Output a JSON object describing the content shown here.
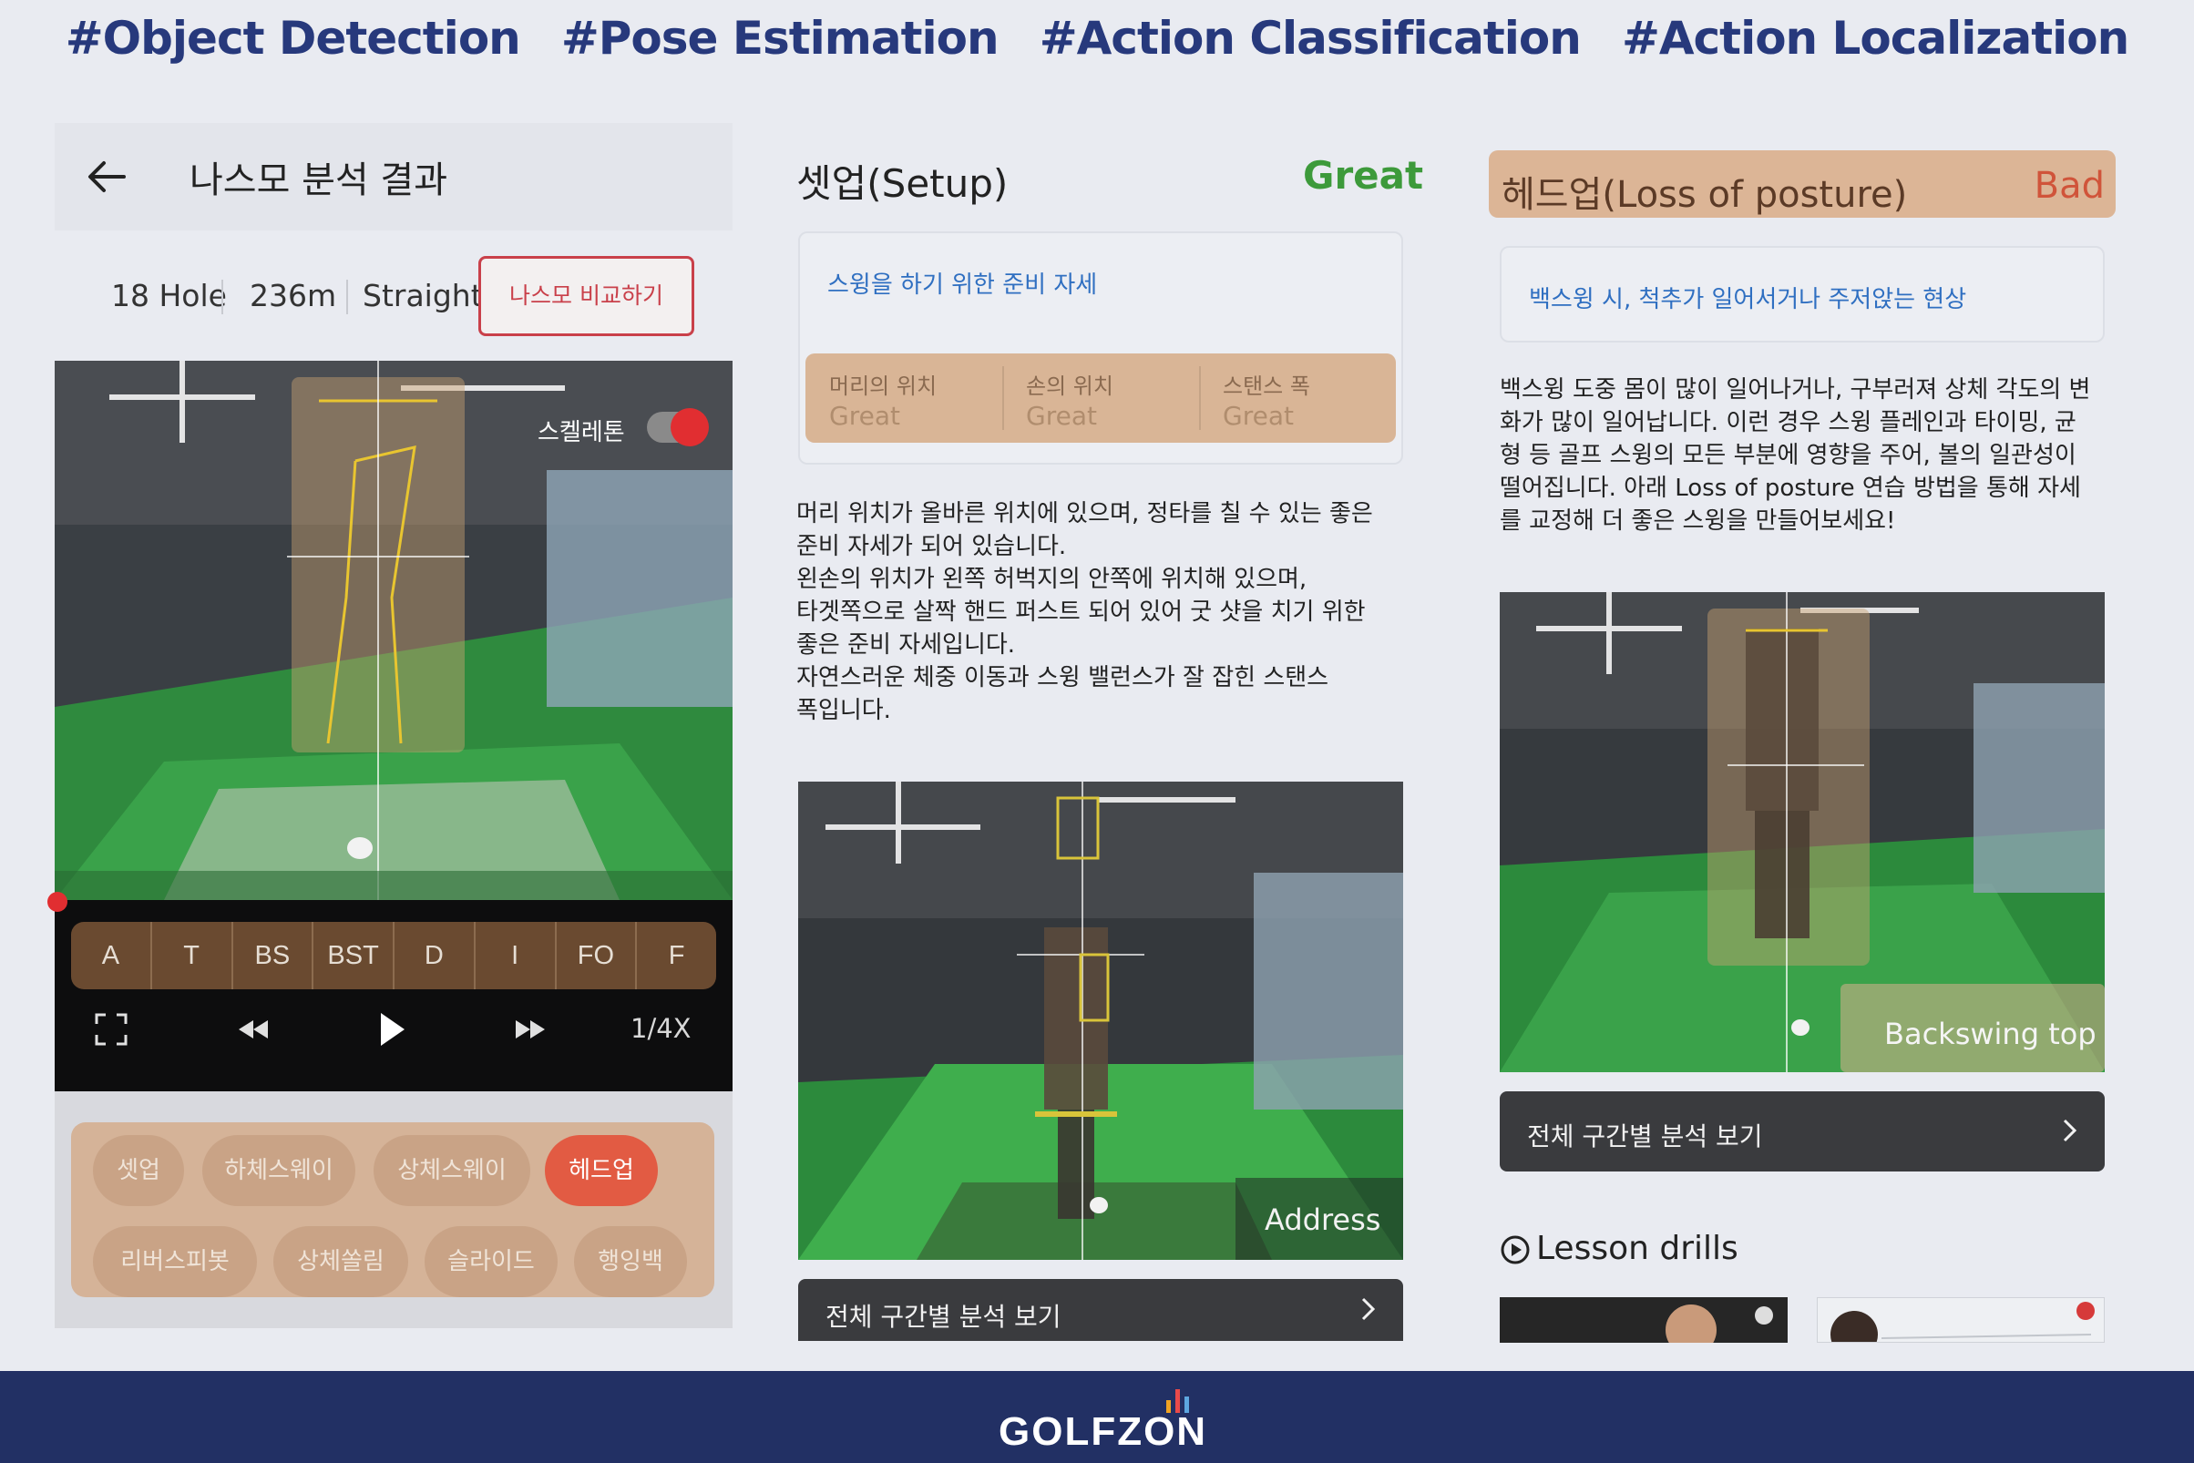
{
  "hashtags": [
    "#Object Detection",
    "#Pose Estimation",
    "#Action Classification",
    "#Action Localization"
  ],
  "panel1": {
    "title": "나스모 분석 결과",
    "hole": "18 Hole",
    "distance": "236m",
    "shot": "Straight",
    "compare_button": "나스모 비교하기",
    "skeleton_label": "스켈레톤",
    "skeleton_on": true,
    "phases": [
      "A",
      "T",
      "BS",
      "BST",
      "D",
      "I",
      "FO",
      "F"
    ],
    "speed": "1/4X",
    "chips": [
      "셋업",
      "하체스웨이",
      "상체스웨이",
      "헤드업",
      "리버스피봇",
      "상체쏠림",
      "슬라이드",
      "행잉백"
    ],
    "active_chip": "헤드업"
  },
  "panel2": {
    "title": "셋업(Setup)",
    "rating": "Great",
    "subtitle": "스윙을 하기 위한 준비 자세",
    "evaluations": [
      {
        "label": "머리의 위치",
        "value": "Great"
      },
      {
        "label": "손의 위치",
        "value": "Great"
      },
      {
        "label": "스탠스 폭",
        "value": "Great"
      }
    ],
    "description": "머리 위치가 올바른 위치에 있으며, 정타를 칠 수 있는 좋은\n준비 자세가 되어 있습니다.\n왼손의 위치가 왼쪽 허벅지의 안쪽에 위치해 있으며,\n타겟쪽으로 살짝 핸드 퍼스트 되어 있어 굿 샷을 치기 위한\n좋은 준비 자세입니다.\n자연스러운 체중 이동과 스윙 밸런스가 잘 잡힌 스탠스\n폭입니다.",
    "video_label": "Address",
    "view_all": "전체 구간별 분석 보기"
  },
  "panel3": {
    "title": "헤드업(Loss of posture)",
    "rating": "Bad",
    "subtitle": "백스윙 시, 척추가 일어서거나 주저앉는 현상",
    "description": "백스윙 도중 몸이 많이 일어나거나, 구부러져 상체 각도의 변화가 많이 일어납니다. 이런 경우 스윙 플레인과 타이밍, 균형 등 골프 스윙의 모든 부분에 영향을 주어, 볼의 일관성이 떨어집니다. 아래 Loss of posture 연습 방법을 통해 자세를 교정해 더 좋은 스윙을 만들어보세요!",
    "video_label": "Backswing top",
    "view_all": "전체 구간별 분석 보기",
    "lesson_title": "Lesson drills"
  },
  "footer": {
    "brand": "GOLFZON"
  },
  "colors": {
    "great": "#3d9a3b",
    "bad": "#d0543a",
    "accent_red": "#c9404a",
    "footer_bg": "#223064",
    "hashtag": "#27397c"
  }
}
